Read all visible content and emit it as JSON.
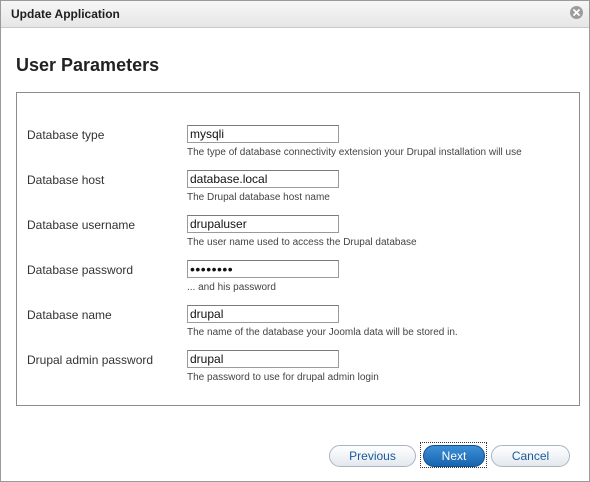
{
  "window": {
    "title": "Update Application"
  },
  "page": {
    "heading": "User Parameters"
  },
  "fields": [
    {
      "label": "Database type",
      "value": "mysqli",
      "type": "text",
      "help": "The type of database connectivity extension your Drupal installation will use"
    },
    {
      "label": "Database host",
      "value": "database.local",
      "type": "text",
      "help": "The Drupal database host name"
    },
    {
      "label": "Database username",
      "value": "drupaluser",
      "type": "text",
      "help": "The user name used to access the Drupal database"
    },
    {
      "label": "Database password",
      "value": "••••••••",
      "type": "password",
      "help": "... and his password"
    },
    {
      "label": "Database name",
      "value": "drupal",
      "type": "text",
      "help": "The name of the database your Joomla data will be stored in."
    },
    {
      "label": "Drupal admin password",
      "value": "drupal",
      "type": "text",
      "help": "The password to use for drupal admin login"
    }
  ],
  "buttons": {
    "previous": "Previous",
    "next": "Next",
    "cancel": "Cancel"
  },
  "icons": {
    "close": "close-icon"
  },
  "colors": {
    "primary_button": "#1f6fbe",
    "link_button_text": "#1a5a9c",
    "panel_border": "#8c8c8c"
  }
}
